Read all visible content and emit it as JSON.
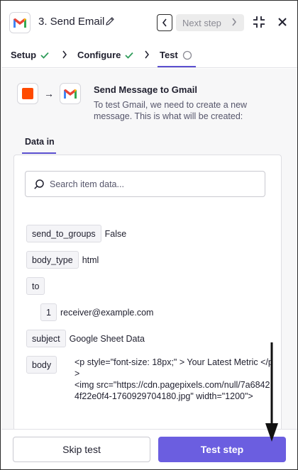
{
  "header": {
    "title": "3. Send Email",
    "app_icon": "gmail-logo",
    "edit_icon": "pencil-icon",
    "prev_icon": "chevron-left-icon",
    "next_label": "Next step",
    "next_icon": "chevron-right-icon",
    "collapse_icon": "collapse-icon",
    "close_icon": "close-icon"
  },
  "steps": [
    {
      "label": "Setup",
      "status": "complete"
    },
    {
      "label": "Configure",
      "status": "complete"
    },
    {
      "label": "Test",
      "status": "current"
    }
  ],
  "card": {
    "title": "Send Message to Gmail",
    "description": "To test Gmail, we need to create a new message. This is what will be created:"
  },
  "tabs": {
    "data_in": "Data in"
  },
  "search": {
    "placeholder": "Search item data..."
  },
  "fields": {
    "send_to_groups": {
      "key": "send_to_groups",
      "value": "False"
    },
    "body_type": {
      "key": "body_type",
      "value": "html"
    },
    "to": {
      "key": "to",
      "index": "1",
      "value": "receiver@example.com"
    },
    "subject": {
      "key": "subject",
      "value": "Google Sheet Data"
    },
    "body": {
      "key": "body",
      "value": "<p style=\"font-size: 18px;\" > Your Latest Metric </p>\n<img src=\"https://cdn.pagepixels.com/null/7a68424f22e0f4-1760929704180.jpg\" width=\"1200\">"
    }
  },
  "footer": {
    "skip_label": "Skip test",
    "test_label": "Test step"
  },
  "colors": {
    "accent": "#6b5ee0",
    "check": "#2e9c5a",
    "source_app": "#ff4a00"
  }
}
